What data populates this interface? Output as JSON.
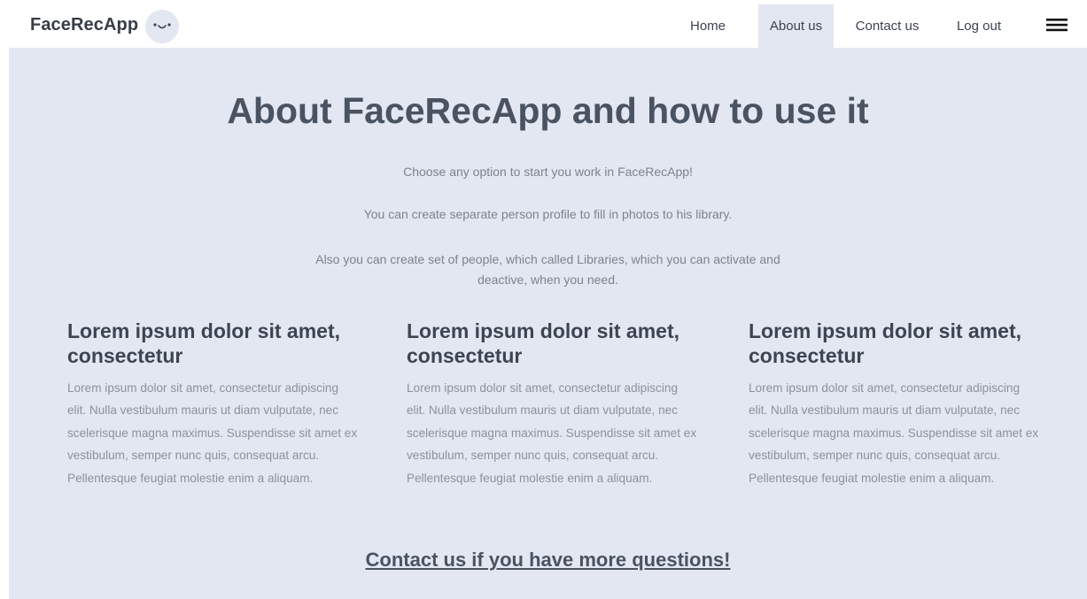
{
  "navbar": {
    "brand": "FaceRecApp",
    "items": [
      {
        "label": "Home",
        "active": false
      },
      {
        "label": "About us",
        "active": true
      },
      {
        "label": "Contact us",
        "active": false
      },
      {
        "label": "Log out",
        "active": false
      }
    ],
    "menu_icon": "hamburger-menu-icon",
    "logo_icon": "smiley-face-icon"
  },
  "main": {
    "title": "About FaceRecApp and how to use it",
    "intro": [
      "Choose any option to start you work in FaceRecApp!",
      "You can create separate person profile to fill in photos to his library.",
      "Also you can create set of people, which called Libraries, which you can activate and deactive, when you need."
    ],
    "columns": [
      {
        "heading": "Lorem ipsum dolor sit amet, consectetur",
        "body": "Lorem ipsum dolor sit amet, consectetur adipiscing elit. Nulla vestibulum mauris ut diam vulputate, nec scelerisque magna maximus. Suspendisse sit amet ex vestibulum, semper nunc quis, consequat arcu. Pellentesque feugiat molestie enim a aliquam."
      },
      {
        "heading": "Lorem ipsum dolor sit amet, consectetur",
        "body": "Lorem ipsum dolor sit amet, consectetur adipiscing elit. Nulla vestibulum mauris ut diam vulputate, nec scelerisque magna maximus. Suspendisse sit amet ex vestibulum, semper nunc quis, consequat arcu. Pellentesque feugiat molestie enim a aliquam."
      },
      {
        "heading": "Lorem ipsum dolor sit amet, consectetur",
        "body": "Lorem ipsum dolor sit amet, consectetur adipiscing elit. Nulla vestibulum mauris ut diam vulputate, nec scelerisque magna maximus. Suspendisse sit amet ex vestibulum, semper nunc quis, consequat arcu. Pellentesque feugiat molestie enim a aliquam."
      }
    ],
    "contact_link": "Contact us if you have more questions!"
  },
  "colors": {
    "page_background": "#e3e7f1",
    "navbar_background": "#ffffff",
    "text_dark": "#4a5361",
    "text_muted": "#8a929e"
  }
}
